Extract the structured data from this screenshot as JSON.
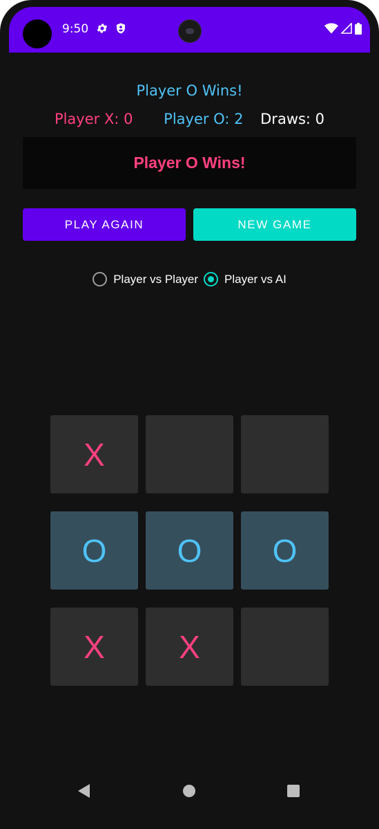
{
  "status_bar": {
    "time": "9:50",
    "left_icons": [
      "gear-icon",
      "shield-icon"
    ],
    "right_icons": [
      "wifi-icon",
      "signal-icon",
      "battery-icon"
    ],
    "color": "#6200ee"
  },
  "game": {
    "status_text": "Player O Wins!",
    "scores": {
      "player_x": "Player X: 0",
      "player_o": "Player O: 2",
      "draws": "Draws: 0"
    },
    "result_message": "Player O Wins!",
    "buttons": {
      "play_again": "PLAY AGAIN",
      "new_game": "NEW GAME"
    },
    "modes": [
      {
        "label": "Player vs Player",
        "selected": false
      },
      {
        "label": "Player vs AI",
        "selected": true
      }
    ],
    "board": [
      [
        "X",
        "",
        ""
      ],
      [
        "O",
        "O",
        "O"
      ],
      [
        "X",
        "X",
        ""
      ]
    ],
    "winning_row": 1
  },
  "colors": {
    "background": "#121212",
    "x_color": "#ff4081",
    "o_color": "#4fc3f7",
    "primary": "#6200ee",
    "secondary": "#03dac5",
    "cell": "#2e2e2e",
    "win_cell": "#364f5c"
  },
  "nav_bar": {
    "icons": [
      "back-icon",
      "home-icon",
      "recents-icon"
    ]
  }
}
